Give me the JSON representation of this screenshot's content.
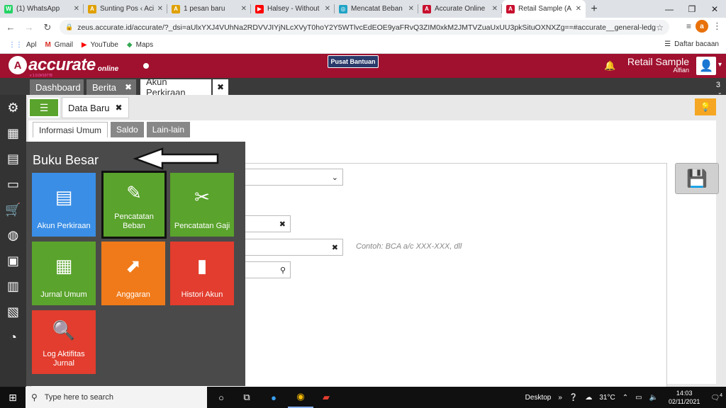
{
  "browser": {
    "tabs": [
      {
        "title": "(1) WhatsApp",
        "color": "#25d366",
        "glyph": "W"
      },
      {
        "title": "Sunting Pos ‹ Aci",
        "color": "#e0a000",
        "glyph": "A"
      },
      {
        "title": "1 pesan baru",
        "color": "#e0a000",
        "glyph": "A"
      },
      {
        "title": "Halsey - Without",
        "color": "#ff0000",
        "glyph": "▶"
      },
      {
        "title": "Mencatat Beban",
        "color": "#1fa3c6",
        "glyph": "◎"
      },
      {
        "title": "Accurate Online",
        "color": "#c8102e",
        "glyph": "A"
      },
      {
        "title": "Retail Sample (A",
        "color": "#c8102e",
        "glyph": "A"
      }
    ],
    "url": "zeus.accurate.id/accurate/?_dsi=aUlxYXJ4VUhNa2RDVVJIYjNLcXVyT0hoY2Y5WTlvcEdEOE9yaFRvQ3ZIM0xkM2JMTVZuaUxUU3pkSituOXNXZg==#accurate__general-ledger__g...",
    "bookmarks": [
      "Apl",
      "Gmail",
      "YouTube",
      "Maps"
    ],
    "reading_list": "Daftar bacaan",
    "profile_initial": "a"
  },
  "app": {
    "logo_text": "accurate",
    "logo_sub": "online",
    "version": "v 1.0.0#10778",
    "help_button": "Pusat Bantuan",
    "company": "Retail Sample",
    "user": "Alfian",
    "tab_count": "3",
    "module_tabs": [
      "Dashboard",
      "Berita",
      "Akun Perkiraan"
    ],
    "data_tab": "Data Baru",
    "sub_tabs": [
      "Informasi Umum",
      "Saldo",
      "Lain-lain"
    ],
    "field_hint": "Contoh: BCA a/c XXX-XXX, dll"
  },
  "menu": {
    "title": "Buku Besar",
    "tiles": [
      {
        "label": "Akun Perkiraan",
        "color": "#3a8ee6"
      },
      {
        "label": "Pencatatan Beban",
        "color": "#5aa32c"
      },
      {
        "label": "Pencatatan Gaji",
        "color": "#5aa32c"
      },
      {
        "label": "Jurnal Umum",
        "color": "#5aa32c"
      },
      {
        "label": "Anggaran",
        "color": "#f07a1a"
      },
      {
        "label": "Histori Akun",
        "color": "#e23d2e"
      },
      {
        "label": "Log Aktifitas Jurnal",
        "color": "#e23d2e"
      }
    ]
  },
  "taskbar": {
    "search_placeholder": "Type here to search",
    "desktop": "Desktop",
    "weather": "31°C",
    "time": "14:03",
    "date": "02/11/2021",
    "notification_count": "4"
  }
}
